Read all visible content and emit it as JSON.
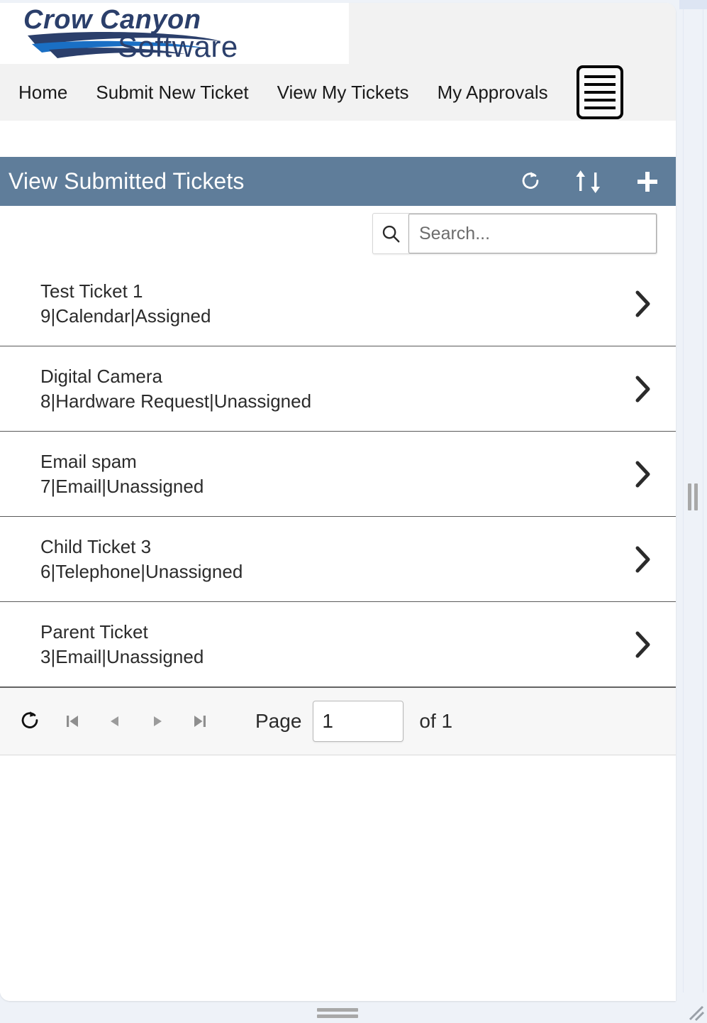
{
  "brand": {
    "logo_line1": "Crow Canyon",
    "logo_line2": "Software",
    "logo_color": "#2b3f6b",
    "logo_accent": "#1a6fc4"
  },
  "nav": {
    "items": [
      {
        "label": "Home",
        "name": "nav-home"
      },
      {
        "label": "Submit New Ticket",
        "name": "nav-submit-new-ticket"
      },
      {
        "label": "View My Tickets",
        "name": "nav-view-my-tickets"
      },
      {
        "label": "My Approvals",
        "name": "nav-my-approvals"
      }
    ],
    "menu_icon": "hamburger-icon"
  },
  "webpart": {
    "title": "View Submitted Tickets",
    "header_color": "#5f7d9a",
    "actions": [
      {
        "label": "Refresh",
        "icon": "refresh-icon"
      },
      {
        "label": "Sort",
        "icon": "sort-updown-icon"
      },
      {
        "label": "Add New",
        "icon": "plus-icon"
      }
    ]
  },
  "search": {
    "placeholder": "Search...",
    "value": "",
    "icon": "search-icon"
  },
  "tickets": [
    {
      "title": "Test Ticket 1",
      "meta": "9|Calendar|Assigned",
      "id": "9",
      "category": "Calendar",
      "status": "Assigned"
    },
    {
      "title": "Digital Camera",
      "meta": "8|Hardware Request|Unassigned",
      "id": "8",
      "category": "Hardware Request",
      "status": "Unassigned"
    },
    {
      "title": "Email spam",
      "meta": "7|Email|Unassigned",
      "id": "7",
      "category": "Email",
      "status": "Unassigned"
    },
    {
      "title": "Child Ticket 3",
      "meta": "6|Telephone|Unassigned",
      "id": "6",
      "category": "Telephone",
      "status": "Unassigned"
    },
    {
      "title": "Parent Ticket",
      "meta": "3|Email|Unassigned",
      "id": "3",
      "category": "Email",
      "status": "Unassigned"
    }
  ],
  "pager": {
    "refresh_icon": "refresh-icon",
    "first_icon": "first-page-icon",
    "prev_icon": "previous-page-icon",
    "next_icon": "next-page-icon",
    "last_icon": "last-page-icon",
    "page_label": "Page",
    "page_value": "1",
    "of_label": "of 1",
    "total_pages": "1"
  }
}
